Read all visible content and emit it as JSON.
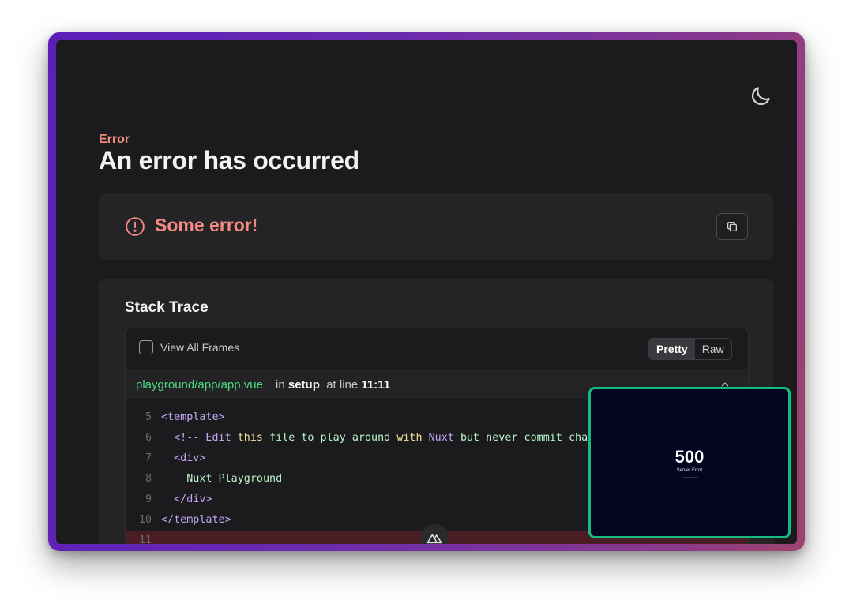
{
  "header": {
    "error_label": "Error",
    "title": "An error has occurred",
    "theme_toggle_icon": "moon-icon"
  },
  "error": {
    "icon": "alert-circle-icon",
    "message": "Some error!",
    "copy_icon": "copy-icon"
  },
  "stack": {
    "title": "Stack Trace",
    "view_all_frames_label": "View All Frames",
    "view_all_frames_checked": false,
    "modes": [
      {
        "label": "Pretty",
        "active": true
      },
      {
        "label": "Raw",
        "active": false
      }
    ],
    "frame": {
      "file": "playground/app/app.vue",
      "in_text": "in",
      "function": "setup",
      "at_text": "at line",
      "location": "11:11",
      "expanded": true
    },
    "code_lines": [
      {
        "n": "5",
        "text": "<template>"
      },
      {
        "n": "6",
        "text": "  <!-- Edit this file to play around with Nuxt but never commit changes"
      },
      {
        "n": "7",
        "text": "  <div>"
      },
      {
        "n": "8",
        "text": "    Nuxt Playground"
      },
      {
        "n": "9",
        "text": "  </div>"
      },
      {
        "n": "10",
        "text": "</template>"
      },
      {
        "n": "11",
        "text": ""
      }
    ],
    "highlighted_line": "11"
  },
  "preview": {
    "status_code": "500",
    "status_text": "Server Error",
    "sub_text": "Some error!"
  },
  "colors": {
    "accent_error": "#f28b82",
    "file_path": "#4ade80",
    "preview_border": "#16b981",
    "frame_gradient_start": "#5b1fb8",
    "frame_gradient_end": "#a0446e"
  },
  "badge_icon": "nuxt-logo-icon"
}
